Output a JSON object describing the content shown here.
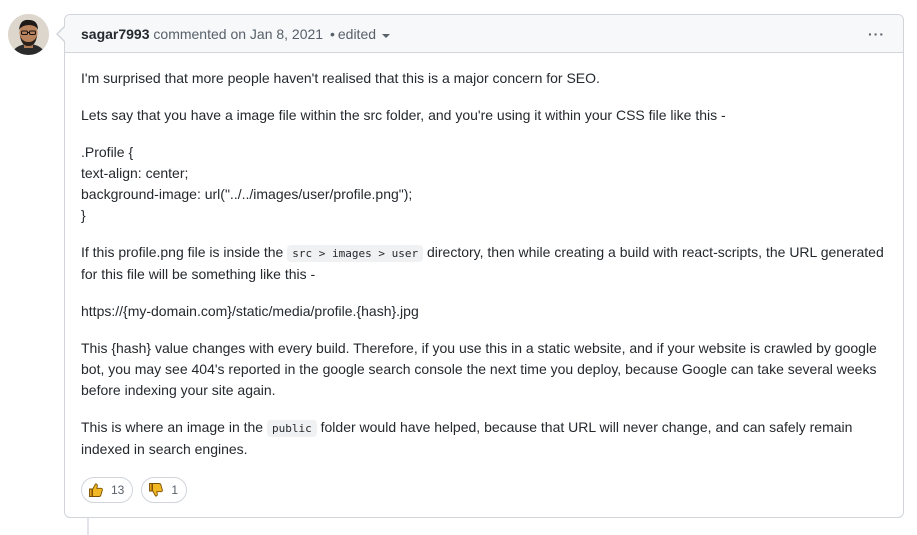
{
  "comment": {
    "author": "sagar7993",
    "action": "commented on",
    "date": "Jan 8, 2021",
    "separator": "•",
    "edited": "edited",
    "menu_icon": "kebab-horizontal-icon",
    "menu_glyph": "···",
    "paragraphs": {
      "p1": "I'm surprised that more people haven't realised that this is a major concern for SEO.",
      "p2": "Lets say that you have a image file within the src folder, and you're using it within your CSS file like this -",
      "css_lines": [
        ".Profile {",
        "text-align: center;",
        "background-image: url(\"../../images/user/profile.png\");",
        "}"
      ],
      "p3_before": "If this profile.png file is inside the",
      "p3_code": "src > images > user",
      "p3_after": "directory, then while creating a build with react-scripts, the URL generated for this file will be something like this -",
      "url_line": "https://{my-domain.com}/static/media/profile.{hash}.jpg",
      "p4": "This {hash} value changes with every build. Therefore, if you use this in a static website, and if your website is crawled by google bot, you may see 404's reported in the google search console the next time you deploy, because Google can take several weeks before indexing your site again.",
      "p5_before": "This is where an image in the",
      "p5_code": "public",
      "p5_after": "folder would have helped, because that URL will never change, and can safely remain indexed in search engines."
    },
    "reactions": [
      {
        "icon": "thumbs-up-icon",
        "count": "13"
      },
      {
        "icon": "thumbs-down-icon",
        "count": "1"
      }
    ]
  },
  "colors": {
    "header_bg": "#f6f8fa",
    "border": "#d1d5da",
    "text": "#24292e",
    "muted": "#586069",
    "reaction_icon": "#e8a21b"
  }
}
